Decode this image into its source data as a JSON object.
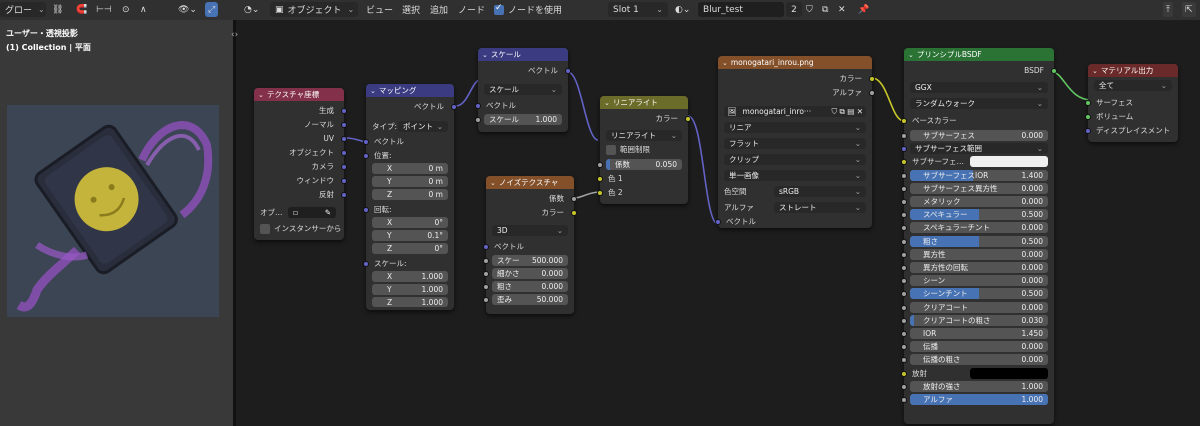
{
  "topbar": {
    "transform": "グロー",
    "mode": "オブジェクト",
    "menus": [
      "ビュー",
      "選択",
      "追加",
      "ノード"
    ],
    "use_nodes": "ノードを使用",
    "slot": "Slot 1",
    "material": "Blur_test",
    "users": "2"
  },
  "viewport": {
    "title": "ユーザー・透視投影",
    "subtitle": "(1) Collection | 平面"
  },
  "nodes": {
    "texcoord": {
      "title": "テクスチャ座標",
      "outputs": [
        "生成",
        "ノーマル",
        "UV",
        "オブジェクト",
        "カメラ",
        "ウィンドウ",
        "反射"
      ],
      "object_label": "オブ…",
      "instancer": "インスタンサーから"
    },
    "mapping": {
      "title": "マッピング",
      "out": "ベクトル",
      "type_label": "タイプ:",
      "type_value": "ポイント",
      "vector": "ベクトル",
      "loc_label": "位置:",
      "loc": [
        {
          "k": "X",
          "v": "0 m"
        },
        {
          "k": "Y",
          "v": "0 m"
        },
        {
          "k": "Z",
          "v": "0 m"
        }
      ],
      "rot_label": "回転:",
      "rot": [
        {
          "k": "X",
          "v": "0°"
        },
        {
          "k": "Y",
          "v": "0.1°"
        },
        {
          "k": "Z",
          "v": "0°"
        }
      ],
      "scale_label": "スケール:",
      "scale": [
        {
          "k": "X",
          "v": "1.000"
        },
        {
          "k": "Y",
          "v": "1.000"
        },
        {
          "k": "Z",
          "v": "1.000"
        }
      ]
    },
    "vscale": {
      "title": "スケール",
      "out": "ベクトル",
      "op": "スケール",
      "vector": "ベクトル",
      "scale_label": "スケール",
      "scale_value": "1.000"
    },
    "noise": {
      "title": "ノイズテクスチャ",
      "out1": "係数",
      "out2": "カラー",
      "dim": "3D",
      "vector": "ベクトル",
      "fields": [
        {
          "k": "スケー",
          "v": "500.000"
        },
        {
          "k": "細かさ",
          "v": "0.000"
        },
        {
          "k": "粗さ",
          "v": "0.000"
        },
        {
          "k": "歪み",
          "v": "50.000"
        }
      ]
    },
    "mix": {
      "title": "リニアライト",
      "out": "カラー",
      "blend": "リニアライト",
      "clamp": "範囲制限",
      "fac_label": "係数",
      "fac_value": "0.050",
      "fac": 0.05,
      "c1": "色 1",
      "c2": "色 2"
    },
    "image": {
      "title": "monogatari_inrou.png",
      "out1": "カラー",
      "out2": "アルファ",
      "file": "monogatari_inro···",
      "interp": "リニア",
      "proj": "フラット",
      "ext": "クリップ",
      "source": "単一画像",
      "cs_label": "色空間",
      "cs": "sRGB",
      "alpha_label": "アルファ",
      "alpha": "ストレート",
      "vector": "ベクトル"
    },
    "bsdf": {
      "title": "プリンシプルBSDF",
      "out": "BSDF",
      "dist": "GGX",
      "sss_method": "ランダムウォーク",
      "base": "ベースカラー",
      "rows": [
        {
          "k": "サブサーフェス",
          "v": "0.000",
          "t": "num",
          "f": 0
        },
        {
          "k": "サブサーフェス範囲",
          "v": "",
          "t": "dd",
          "f": 0
        },
        {
          "k": "サブサーフェ…",
          "v": "",
          "t": "color",
          "f": 0
        },
        {
          "k": "サブサーフェスIOR",
          "v": "1.400",
          "t": "num",
          "f": 0.46
        },
        {
          "k": "サブサーフェス異方性",
          "v": "0.000",
          "t": "num",
          "f": 0
        },
        {
          "k": "メタリック",
          "v": "0.000",
          "t": "num",
          "f": 0
        },
        {
          "k": "スペキュラー",
          "v": "0.500",
          "t": "num",
          "f": 0.5
        },
        {
          "k": "スペキュラーチント",
          "v": "0.000",
          "t": "num",
          "f": 0
        },
        {
          "k": "粗さ",
          "v": "0.500",
          "t": "num",
          "f": 0.5
        },
        {
          "k": "異方性",
          "v": "0.000",
          "t": "num",
          "f": 0
        },
        {
          "k": "異方性の回転",
          "v": "0.000",
          "t": "num",
          "f": 0
        },
        {
          "k": "シーン",
          "v": "0.000",
          "t": "num",
          "f": 0
        },
        {
          "k": "シーンチント",
          "v": "0.500",
          "t": "num",
          "f": 0.5
        },
        {
          "k": "クリアコート",
          "v": "0.000",
          "t": "num",
          "f": 0
        },
        {
          "k": "クリアコートの粗さ",
          "v": "0.030",
          "t": "num",
          "f": 0.03
        },
        {
          "k": "IOR",
          "v": "1.450",
          "t": "num",
          "f": 0
        },
        {
          "k": "伝播",
          "v": "0.000",
          "t": "num",
          "f": 0
        },
        {
          "k": "伝播の粗さ",
          "v": "0.000",
          "t": "num",
          "f": 0
        },
        {
          "k": "放射",
          "v": "",
          "t": "black",
          "f": 0
        },
        {
          "k": "放射の強さ",
          "v": "1.000",
          "t": "num",
          "f": 0
        },
        {
          "k": "アルファ",
          "v": "1.000",
          "t": "num",
          "f": 1
        }
      ]
    },
    "output": {
      "title": "マテリアル出力",
      "target": "全て",
      "inputs": [
        "サーフェス",
        "ボリューム",
        "ディスプレイスメント"
      ]
    }
  },
  "colors": {
    "accent": "#4772b3",
    "vector_socket": "#6363c7",
    "color_socket": "#c7c729",
    "shader_socket": "#63c763"
  }
}
